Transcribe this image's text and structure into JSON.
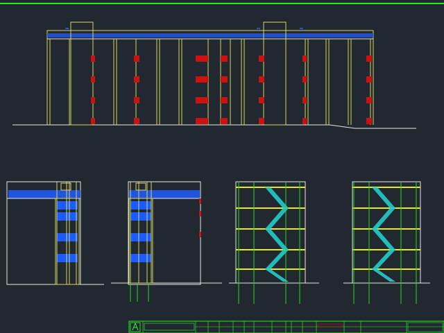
{
  "drawing": {
    "background": "#212830",
    "colors": {
      "frame": "#22ee22",
      "wall": "#d8d860",
      "line_white": "#e8e8e8",
      "window_red": "#cc1111",
      "roof_blue": "#2255dd",
      "glass_blue": "#1a5cff",
      "stair_cyan": "#22cccc",
      "slab_yellow": "#e8e820",
      "green_line": "#22dd22"
    }
  },
  "title_block": {
    "cells": [
      "",
      "",
      "",
      "",
      "",
      "",
      "",
      "",
      "",
      "",
      "",
      "",
      ""
    ]
  },
  "icons": {
    "logo": "company-logo-icon"
  }
}
